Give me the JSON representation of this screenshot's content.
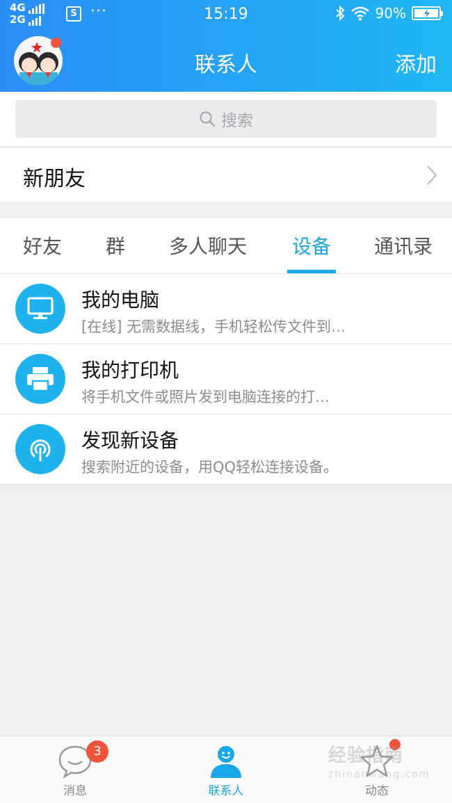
{
  "status_bar": {
    "network_top": "4G",
    "network_bottom": "2G",
    "sim_glyph": "S",
    "dots": "···",
    "time": "15:19",
    "battery_percent": "90%",
    "icons": [
      "signal-icon",
      "sim-icon",
      "bluetooth-icon",
      "wifi-icon",
      "battery-icon"
    ]
  },
  "header": {
    "title": "联系人",
    "add_label": "添加"
  },
  "search": {
    "placeholder": "搜索"
  },
  "new_friend": {
    "label": "新朋友"
  },
  "tabs": [
    {
      "label": "好友",
      "active": false
    },
    {
      "label": "群",
      "active": false
    },
    {
      "label": "多人聊天",
      "active": false
    },
    {
      "label": "设备",
      "active": true
    },
    {
      "label": "通讯录",
      "active": false
    }
  ],
  "devices": [
    {
      "name": "我的电脑",
      "desc": "[在线] 无需数据线，手机轻松传文件到…",
      "icon": "monitor-icon"
    },
    {
      "name": "我的打印机",
      "desc": "将手机文件或照片发到电脑连接的打…",
      "icon": "printer-icon"
    },
    {
      "name": "发现新设备",
      "desc": "搜索附近的设备，用QQ轻松连接设备。",
      "icon": "radar-icon"
    }
  ],
  "bottom_nav": [
    {
      "label": "消息",
      "badge": "3",
      "icon": "chat-bubble-icon"
    },
    {
      "label": "联系人",
      "icon": "contact-person-icon",
      "active": true
    },
    {
      "label": "动态",
      "icon": "star-icon",
      "dot": true
    }
  ],
  "watermark": {
    "line1": "经验指南",
    "line2": "zhinanwang.com"
  },
  "colors": {
    "header_gradient_start": "#2a8ef7",
    "header_gradient_end": "#20b7f4",
    "accent": "#1aa7e8",
    "badge": "#f2543a",
    "device_icon_bg": "#1fb3ee"
  }
}
